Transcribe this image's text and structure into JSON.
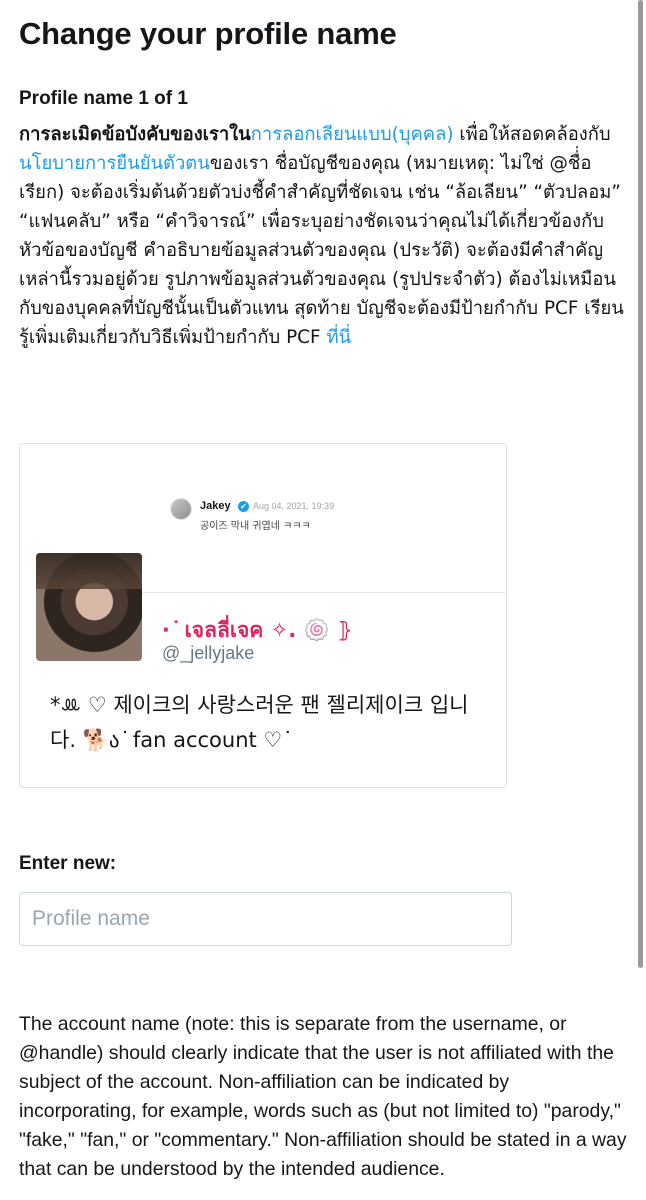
{
  "page_title": "Change your profile name",
  "counter": "Profile name 1 of 1",
  "intro": {
    "bold_lead": "การละเมิดข้อบังคับของเราใน",
    "link1": "การลอกเลียนแบบ(บุคคล)",
    "text1": " เพื่อให้สอดคล้องกับ",
    "link2": "นโยบายการยืนยันตัวตน",
    "text2": "ของเรา ชื่อบัญชีของคุณ (หมายเหตุ: ไม่ใช่ @ชื่่อเรียก) จะต้องเริ่มต้นด้วยตัวบ่งชี้คำสำคัญที่ชัดเจน เช่น “ล้อเลียน” “ตัวปลอม” “แฟนคลับ” หรือ “คำวิจารณ์” เพื่อระบุอย่างชัดเจนว่าคุณไม่ได้เกี่ยวข้องกับหัวข้อของบัญชี คำอธิบายข้อมูลส่วนตัวของคุณ (ประวัติ) จะต้องมีคำสำคัญเหล่านี้รวมอยู่ด้วย รูปภาพข้อมูลส่วนตัวของคุณ (รูปประจำตัว) ต้องไม่เหมือนกับของบุคคลที่บัญชีนั้นเป็นตัวแทน สุดท้าย บัญชีจะต้องมีป้ายกำกับ PCF เรียนรู้เพิ่มเติมเกี่ยวกับวิธีเพิ่มป้ายกำกับ PCF ",
    "link3": "ที่นี่"
  },
  "card": {
    "reply": {
      "name": "Jakey",
      "verified_icon": "✔",
      "date": "Aug 04, 2021, 19:39",
      "text": "공이즈 막내 귀엽네 ㅋㅋㅋ"
    },
    "display_name": "⋅ ͘ เจลลี่เจค ✧. 🍥 ⦄",
    "handle": "@_jellyjake",
    "bio": "*ꔛ ♡ 제이크의 사랑스러운 팬 젤리제이크 입니다. 🐕ა ͘ fan account ♡ ͘"
  },
  "enter_label": "Enter new:",
  "input": {
    "placeholder": "Profile name",
    "value": ""
  },
  "explanation": "The account name (note: this is separate from the username, or @handle) should clearly indicate that the user is not affiliated with the subject of the account. Non-affiliation can be indicated by incorporating, for example, words such as (but not limited to) \"parody,\" \"fake,\" \"fan,\" or \"commentary.\" Non-affiliation should be stated in a way that can be understood by the intended audience.",
  "colors": {
    "link": "#1d9bf0",
    "display_name": "#e0245e",
    "handle": "#657786"
  }
}
